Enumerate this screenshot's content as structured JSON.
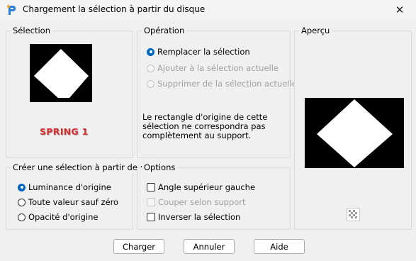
{
  "window": {
    "title": "Chargement la sélection à partir du disque",
    "close_glyph": "✕"
  },
  "selection": {
    "label": "Sélection",
    "thumbnail_caption": "SPRING 1",
    "caption_color": "#d73030"
  },
  "operation": {
    "label": "Opération",
    "options": [
      {
        "label": "Remplacer la sélection",
        "selected": true,
        "enabled": true
      },
      {
        "label": "Ajouter à la sélection actuelle",
        "selected": false,
        "enabled": false
      },
      {
        "label": "Supprimer de la sélection actuelle",
        "selected": false,
        "enabled": false
      }
    ],
    "info": "Le rectangle d'origine de cette sélection ne correspondra pas complètement au support."
  },
  "create_from": {
    "label": "Créer une sélection à partir de :",
    "options": [
      {
        "label": "Luminance d'origine",
        "selected": true
      },
      {
        "label": "Toute valeur sauf zéro",
        "selected": false
      },
      {
        "label": "Opacité d'origine",
        "selected": false
      }
    ]
  },
  "options": {
    "label": "Options",
    "items": [
      {
        "label": "Angle supérieur gauche",
        "checked": false,
        "enabled": true
      },
      {
        "label": "Couper selon support",
        "checked": false,
        "enabled": false
      },
      {
        "label": "Inverser la sélection",
        "checked": false,
        "enabled": true
      }
    ]
  },
  "preview": {
    "label": "Aperçu",
    "transparency_icon": "checkerboard-icon"
  },
  "buttons": {
    "load": "Charger",
    "cancel": "Annuler",
    "help": "Aide"
  },
  "colors": {
    "accent": "#0067c0",
    "background": "#f0f0f0"
  }
}
